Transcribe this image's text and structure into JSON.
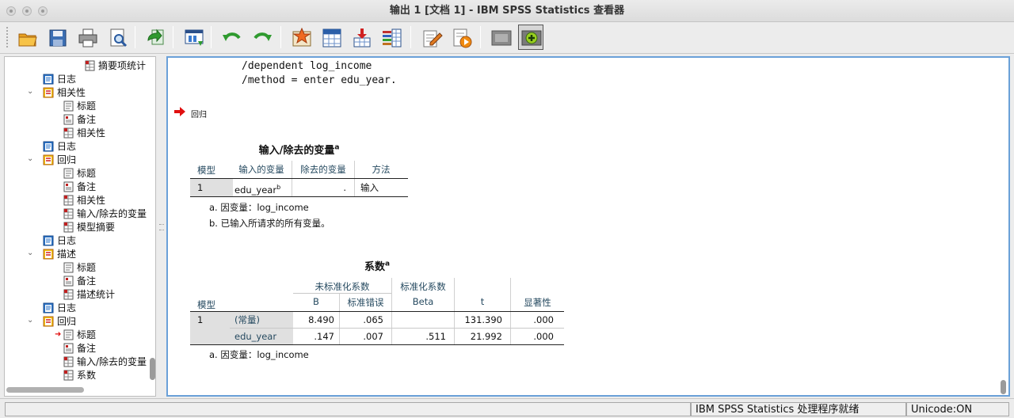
{
  "window": {
    "title": "输出 1 [文档 1] - IBM SPSS Statistics 查看器"
  },
  "toolbar": {
    "buttons": [
      "open-icon",
      "save-icon",
      "print-icon",
      "print-preview-icon",
      "export-icon",
      "recall-dialog-icon",
      "undo-icon",
      "redo-icon",
      "goto-data-icon",
      "goto-case-icon",
      "goto-variable-icon",
      "variables-icon",
      "designate-window-icon",
      "show-all-icon",
      "hide-icon",
      "insert-icon"
    ]
  },
  "outline": {
    "items": [
      {
        "label": "摘要项统计",
        "icon": "table-icon"
      },
      {
        "label": "日志",
        "icon": "log-icon"
      },
      {
        "label": "相关性",
        "icon": "procedure-icon",
        "expanded": true
      },
      {
        "label": "标题",
        "icon": "title-icon"
      },
      {
        "label": "备注",
        "icon": "notes-icon"
      },
      {
        "label": "相关性",
        "icon": "table-icon"
      },
      {
        "label": "日志",
        "icon": "log-icon"
      },
      {
        "label": "回归",
        "icon": "procedure-icon",
        "expanded": true
      },
      {
        "label": "标题",
        "icon": "title-icon"
      },
      {
        "label": "备注",
        "icon": "notes-icon"
      },
      {
        "label": "相关性",
        "icon": "table-icon"
      },
      {
        "label": "输入/除去的变量",
        "icon": "table-icon"
      },
      {
        "label": "模型摘要",
        "icon": "table-icon"
      },
      {
        "label": "日志",
        "icon": "log-icon"
      },
      {
        "label": "描述",
        "icon": "procedure-icon",
        "expanded": true
      },
      {
        "label": "标题",
        "icon": "title-icon"
      },
      {
        "label": "备注",
        "icon": "notes-icon"
      },
      {
        "label": "描述统计",
        "icon": "table-icon"
      },
      {
        "label": "日志",
        "icon": "log-icon"
      },
      {
        "label": "回归",
        "icon": "procedure-icon",
        "expanded": true
      },
      {
        "label": "标题",
        "icon": "title-icon",
        "current": true
      },
      {
        "label": "备注",
        "icon": "notes-icon"
      },
      {
        "label": "输入/除去的变量",
        "icon": "table-icon"
      },
      {
        "label": "系数",
        "icon": "table-icon"
      }
    ]
  },
  "output": {
    "syntax_lines": [
      "/dependent log_income",
      "/method = enter edu_year."
    ],
    "heading": "回归",
    "table1": {
      "title": "输入/除去的变量",
      "title_sup": "a",
      "headers": [
        "模型",
        "输入的变量",
        "除去的变量",
        "方法"
      ],
      "row": {
        "model": "1",
        "entered": "edu_year",
        "entered_sup": "b",
        "removed": ".",
        "method": "输入"
      },
      "footnotes": [
        "a. 因变量：log_income",
        "b. 已输入所请求的所有变量。"
      ]
    },
    "table2": {
      "title": "系数",
      "title_sup": "a",
      "group_headers": [
        "未标准化系数",
        "标准化系数"
      ],
      "headers": [
        "模型",
        "B",
        "标准错误",
        "Beta",
        "t",
        "显著性"
      ],
      "rows": [
        {
          "model": "1",
          "name": "(常量)",
          "B": "8.490",
          "se": ".065",
          "beta": "",
          "t": "131.390",
          "sig": ".000"
        },
        {
          "model": "",
          "name": "edu_year",
          "B": ".147",
          "se": ".007",
          "beta": ".511",
          "t": "21.992",
          "sig": ".000"
        }
      ],
      "footnotes": [
        "a. 因变量：log_income"
      ]
    }
  },
  "status": {
    "main": "IBM SPSS Statistics 处理程序就绪",
    "unicode": "Unicode:ON"
  }
}
